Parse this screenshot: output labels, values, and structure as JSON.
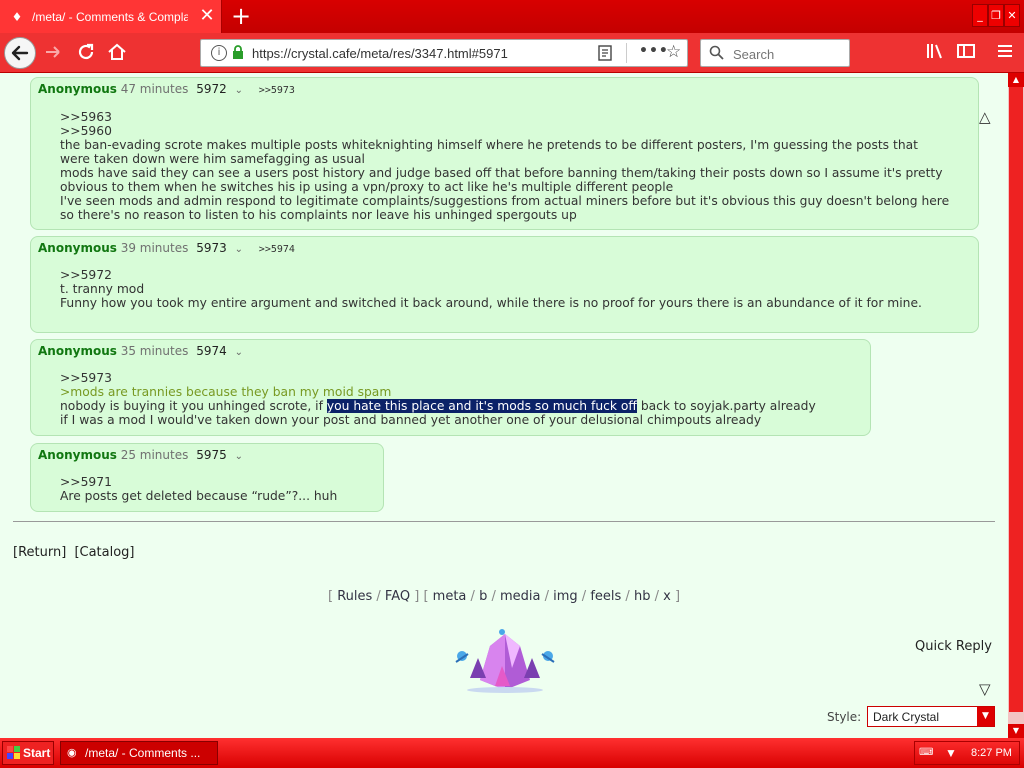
{
  "browser": {
    "tab_title": "/meta/ - Comments & Complaints",
    "url": "https://crystal.cafe/meta/res/3347.html#5971",
    "search_placeholder": "Search",
    "new_tab": "+"
  },
  "posts": [
    {
      "name": "Anonymous",
      "time": "47 minutes",
      "number": "5972",
      "backlinks": ">>5973",
      "lines": [
        {
          "text": ">>5963",
          "type": "quote"
        },
        {
          "text": ">>5960",
          "type": "quote"
        },
        {
          "text": "the ban-evading scrote makes multiple posts whiteknighting himself where he pretends to be different posters, I'm guessing the posts that were taken down were him samefagging as usual",
          "type": "text"
        },
        {
          "text": "mods have said they can see a users post history and judge based off that before banning them/taking their posts down so I assume it's pretty obvious to them when he switches his ip using a vpn/proxy to act like he's multiple different people",
          "type": "text"
        },
        {
          "text": "I've seen mods and admin respond to legitimate complaints/suggestions from actual miners before but it's obvious this guy doesn't belong here so there's no reason to listen to his complaints nor leave his unhinged spergouts up",
          "type": "text"
        }
      ]
    },
    {
      "name": "Anonymous",
      "time": "39 minutes",
      "number": "5973",
      "backlinks": ">>5974",
      "lines": [
        {
          "text": ">>5972",
          "type": "quote"
        },
        {
          "text": "t. tranny mod",
          "type": "text"
        },
        {
          "text": "Funny how you took my entire argument and switched it back around, while there is no proof for yours there is an abundance of it for mine.",
          "type": "text"
        }
      ]
    },
    {
      "name": "Anonymous",
      "time": "35 minutes",
      "number": "5974",
      "backlinks": "",
      "line1": ">>5973",
      "greentext": ">mods are trannies because they ban my moid spam",
      "line3_before": "nobody is buying it you unhinged scrote, if ",
      "line3_highlight": "you hate this place and it's mods so much fuck off",
      "line3_after": " back to soyjak.party already",
      "line4": "if I was a mod I would've taken down your post and banned yet another one of your delusional chimpouts already"
    },
    {
      "name": "Anonymous",
      "time": "25 minutes",
      "number": "5975",
      "backlinks": "",
      "lines": [
        {
          "text": ">>5971",
          "type": "quote"
        },
        {
          "text": "Are posts get deleted because “rude”?... huh",
          "type": "text"
        }
      ]
    }
  ],
  "footer": {
    "return": "[Return]",
    "catalog": "[Catalog]",
    "boardnav": {
      "open1": "[ ",
      "rules": "Rules",
      "sep": " / ",
      "faq": "FAQ",
      "close1": " ]",
      "open2": " [ ",
      "meta": "meta",
      "b": "b",
      "media": "media",
      "img": "img",
      "feels": "feels",
      "hb": "hb",
      "x": "x",
      "close2": " ]"
    },
    "quick_reply": "Quick Reply",
    "style_label": "Style:",
    "style_value": "Dark Crystal"
  },
  "taskbar": {
    "start": "Start",
    "task": "/meta/ - Comments ...",
    "clock": "8:27 PM"
  },
  "colors": {
    "chrome_red": "#e00000",
    "post_bg": "#d8fcd8",
    "name_green": "#117711",
    "greentext": "#789922",
    "highlight": "#0b2268"
  }
}
